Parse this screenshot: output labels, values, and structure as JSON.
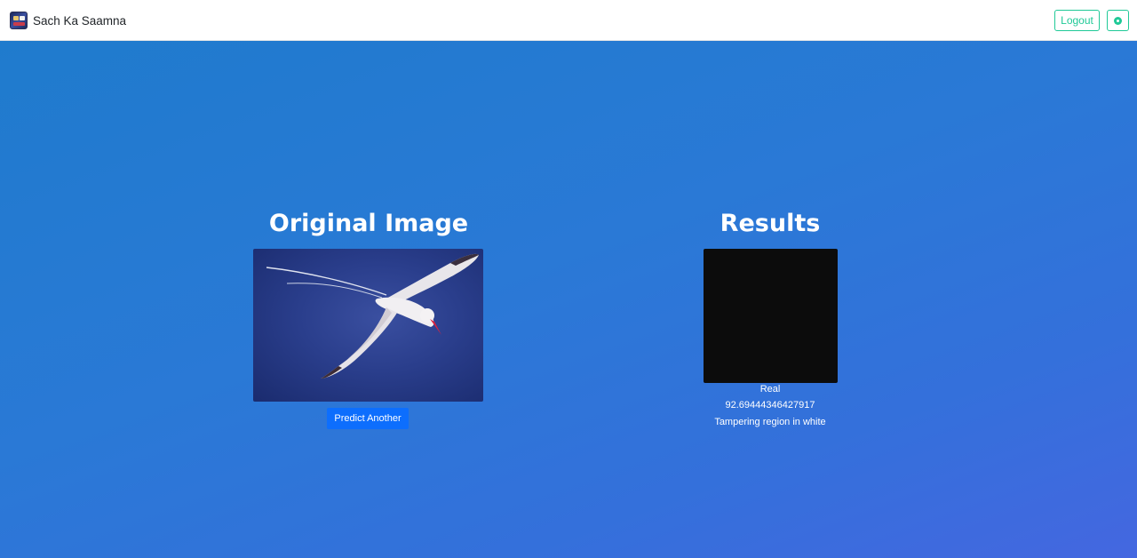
{
  "navbar": {
    "brand": "Sach Ka Saamna",
    "logout_label": "Logout",
    "settings_icon": "gear-icon"
  },
  "main": {
    "original_title": "Original Image",
    "results_title": "Results",
    "predict_label": "Predict Another",
    "result_label": "Real",
    "result_score": "92.69444346427917",
    "result_note": "Tampering region in white"
  },
  "colors": {
    "accent": "#20c997",
    "primary_button": "#0d6efd",
    "hero_start": "#1f7bcd",
    "hero_end": "#4467e0",
    "mask_background": "#0c0c0c"
  }
}
